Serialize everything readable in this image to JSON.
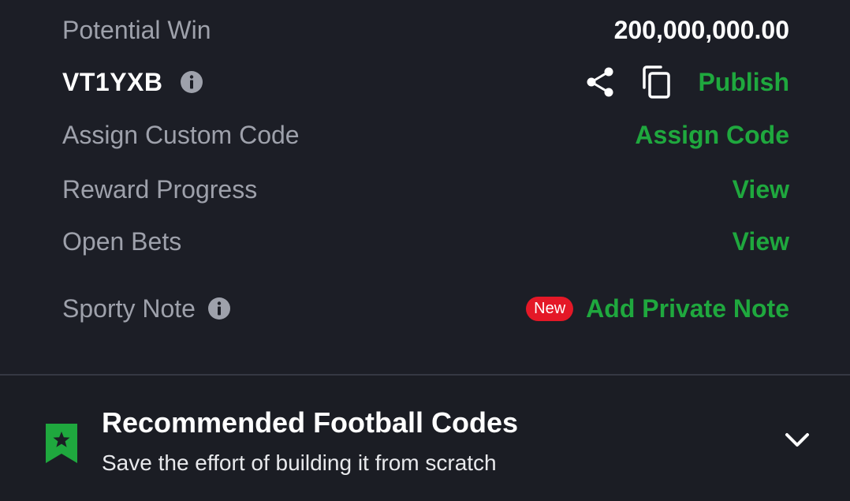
{
  "summary": {
    "potential_win_label": "Potential Win",
    "potential_win_value": "200,000,000.00",
    "booking_code": "VT1YXB",
    "publish_label": "Publish",
    "assign_label": "Assign Custom Code",
    "assign_action": "Assign Code",
    "reward_label": "Reward Progress",
    "reward_action": "View",
    "open_bets_label": "Open Bets",
    "open_bets_action": "View",
    "note_label": "Sporty Note",
    "new_badge": "New",
    "note_action": "Add Private Note"
  },
  "recommended": {
    "title": "Recommended Football Codes",
    "subtitle": "Save the effort of building it from scratch"
  },
  "icons": {
    "info": "info-icon",
    "share": "share-icon",
    "copy": "copy-icon",
    "bookmark": "bookmark-star-icon",
    "chevron": "chevron-down-icon"
  },
  "colors": {
    "background": "#1c1e26",
    "accent_green": "#1fa83e",
    "badge_red": "#e41827",
    "muted_text": "#9ea1ab"
  }
}
